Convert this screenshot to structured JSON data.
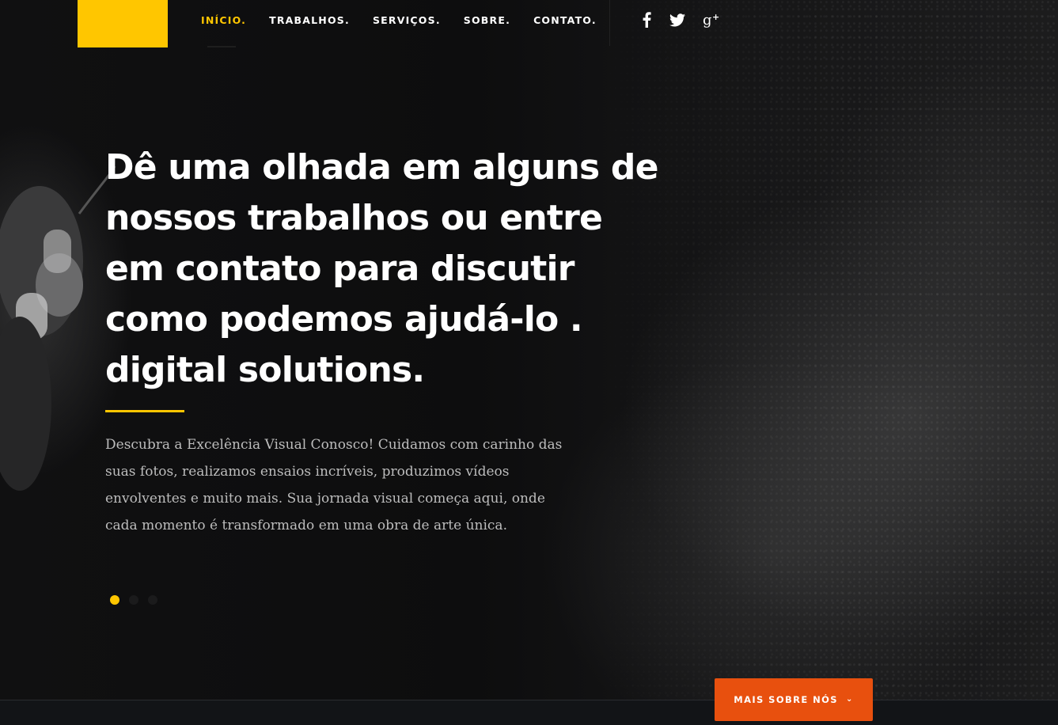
{
  "nav": {
    "items": [
      {
        "label": "INÍCIO.",
        "active": true
      },
      {
        "label": "TRABALHOS.",
        "active": false
      },
      {
        "label": "SERVIÇOS.",
        "active": false
      },
      {
        "label": "SOBRE.",
        "active": false
      },
      {
        "label": "CONTATO.",
        "active": false
      }
    ]
  },
  "social": {
    "facebook": {
      "icon": "facebook-icon",
      "glyph": "f"
    },
    "twitter": {
      "icon": "twitter-icon"
    },
    "google_plus": {
      "icon": "google-plus-icon",
      "glyph": "g+"
    }
  },
  "hero": {
    "headline": "Dê uma olhada em alguns de nossos trabalhos ou entre em contato para discutir como podemos ajudá-lo . digital solutions.",
    "description": "Descubra a Excelência Visual Conosco! Cuidamos com carinho das suas fotos, realizamos ensaios incríveis, produzimos vídeos envolventes e muito mais. Sua jornada visual começa aqui, onde cada momento é transformado em uma obra de arte única."
  },
  "slider": {
    "count": 3,
    "active_index": 0
  },
  "cta": {
    "label": "MAIS SOBRE NÓS",
    "chevron": "⌄",
    "chevron_icon": "chevron-down-icon"
  },
  "colors": {
    "accent": "#ffc600",
    "cta": "#e8500e",
    "background": "#0e0e0f"
  }
}
